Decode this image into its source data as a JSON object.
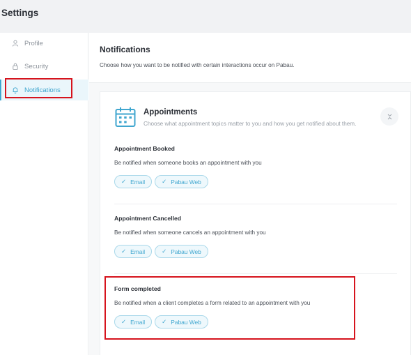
{
  "app": {
    "title": "Settings"
  },
  "sidebar": {
    "items": [
      {
        "label": "Profile",
        "icon": "user-icon",
        "active": false
      },
      {
        "label": "Security",
        "icon": "lock-icon",
        "active": false
      },
      {
        "label": "Notifications",
        "icon": "bell-icon",
        "active": true
      }
    ]
  },
  "page": {
    "title": "Notifications",
    "subtitle": "Choose how you want to be notified with certain interactions occur on Pabau."
  },
  "section": {
    "title": "Appointments",
    "subtitle": "Choose what appointment topics matter to you and how you get notified about them.",
    "icon": "calendar-icon",
    "collapse_icon": "collapse-icon",
    "topics": [
      {
        "title": "Appointment Booked",
        "description": "Be notified when someone books an appointment with you",
        "channels": [
          "Email",
          "Pabau Web"
        ]
      },
      {
        "title": "Appointment Cancelled",
        "description": "Be notified when someone cancels an appointment with you",
        "channels": [
          "Email",
          "Pabau Web"
        ]
      },
      {
        "title": "Form completed",
        "description": "Be notified when a client completes a form related to an appointment with you",
        "channels": [
          "Email",
          "Pabau Web"
        ]
      }
    ]
  },
  "colors": {
    "accent": "#3fa6cf",
    "highlight": "#d6131d",
    "header_bg": "#f1f2f4"
  }
}
